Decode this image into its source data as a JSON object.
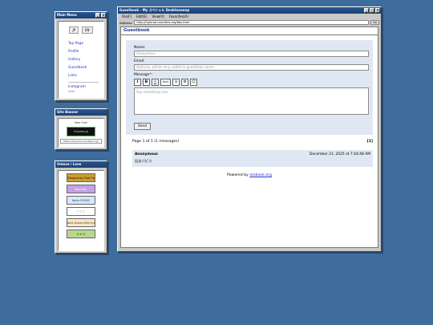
{
  "menu_window": {
    "title": "Main Menu",
    "langs": [
      "JP",
      "EN"
    ],
    "items": [
      "Top Page",
      "Profile",
      "Gallery",
      "Guestbook",
      "Links"
    ],
    "instagram": "Instagram",
    "instagram_sub": "Dum"
  },
  "banner_window": {
    "title": "Site Banner",
    "take": "Take One!",
    "banner_text": "fujiurao.jp",
    "url": "https://fujiurao.neocities.org/"
  },
  "unlove_window": {
    "title": "Unlove / Love",
    "badges": [
      "Designed by Pixel Font",
      "Neocities",
      "Nokia STUDIO",
      "♡ ♡ ♡",
      "Best Viewed With Eyes",
      "☘ ☘ ☘"
    ]
  },
  "main_window": {
    "title": "Guestbook - My スペシャル Desktoooeop",
    "menubar": [
      "File(F)",
      "Edit(E)",
      "View(V)",
      "Favorites(A)"
    ],
    "address_label": "Address:",
    "address": "http://fujiurao.neocities.org/bbs.html",
    "go": "Go",
    "page_title": "Guestbook"
  },
  "form": {
    "name_label": "Name:",
    "name_placeholder": "Anonymous",
    "email_label": "Email:",
    "email_placeholder": "Optional, will be only visible to guestbook owner",
    "message_label": "Message*:",
    "message_placeholder": "Say something nice",
    "toolbar": [
      "I",
      "B",
      "A",
      "font",
      "à",
      "⚙",
      "☺"
    ],
    "send": "Send"
  },
  "pager": {
    "summary": "Page 1 of 1 (1 messages)",
    "page": "[1]"
  },
  "entries": [
    {
      "name": "Anonymous",
      "date": "December 21, 2025 at 7:44:48 AM",
      "message": "記念パピコ"
    }
  ],
  "footer": {
    "powered_prefix": "Powered by",
    "powered_link": "atabook.org"
  }
}
